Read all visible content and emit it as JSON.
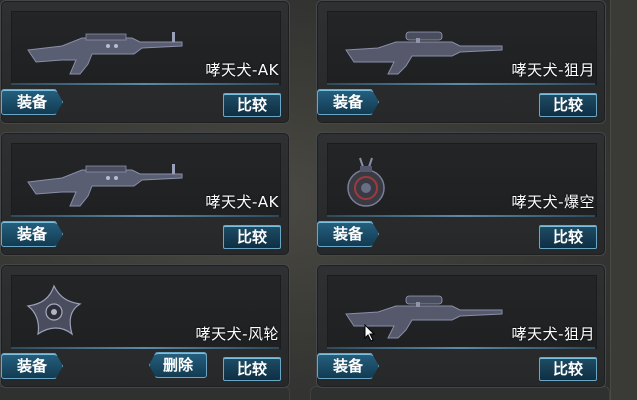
{
  "inventory": {
    "items": [
      {
        "name": "哮天犬-AK",
        "icon": "rifle-icon",
        "equip_label": "装备",
        "compare_label": "比较"
      },
      {
        "name": "哮天犬-狙月",
        "icon": "sniper-rifle-icon",
        "equip_label": "装备",
        "compare_label": "比较"
      },
      {
        "name": "哮天犬-AK",
        "icon": "rifle-icon",
        "equip_label": "装备",
        "compare_label": "比较"
      },
      {
        "name": "哮天犬-爆空",
        "icon": "grenade-icon",
        "equip_label": "装备",
        "compare_label": "比较"
      },
      {
        "name": "哮天犬-风轮",
        "icon": "throwing-star-icon",
        "equip_label": "装备",
        "compare_label": "比较",
        "delete_label": "删除"
      },
      {
        "name": "哮天犬-狙月",
        "icon": "sniper-rifle-icon",
        "equip_label": "装备",
        "compare_label": "比较"
      }
    ]
  },
  "colors": {
    "button_fill": "#1a4d6a",
    "button_border": "#6aa6c6",
    "card_bg": "#26282a",
    "accent_line": "#5c8aa6"
  }
}
